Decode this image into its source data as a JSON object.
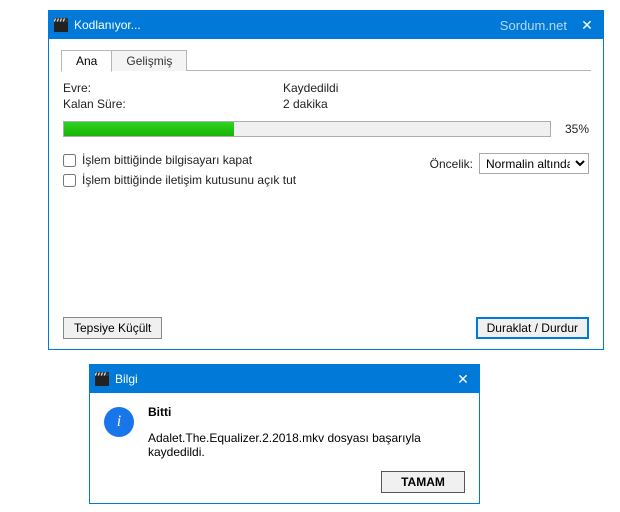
{
  "encoding_window": {
    "title": "Kodlanıyor...",
    "watermark": "Sordum.net",
    "tabs": {
      "main": "Ana",
      "advanced": "Gelişmiş"
    },
    "labels": {
      "phase": "Evre:",
      "time_left": "Kalan Süre:",
      "priority": "Öncelik:"
    },
    "values": {
      "phase": "Kaydedildi",
      "time_left": "2 dakika"
    },
    "progress": {
      "percent_text": "35%",
      "percent_value": 35
    },
    "checkboxes": {
      "shutdown": "İşlem bittiğinde bilgisayarı kapat",
      "keep_dialog": "İşlem bittiğinde iletişim kutusunu açık tut"
    },
    "priority_selected": "Normalin altında",
    "buttons": {
      "minimize_tray": "Tepsiye Küçült",
      "pause_stop": "Duraklat / Durdur"
    }
  },
  "info_dialog": {
    "title": "Bilgi",
    "heading": "Bitti",
    "message": "Adalet.The.Equalizer.2.2018.mkv dosyası başarıyla kaydedildi.",
    "ok": "TAMAM"
  }
}
